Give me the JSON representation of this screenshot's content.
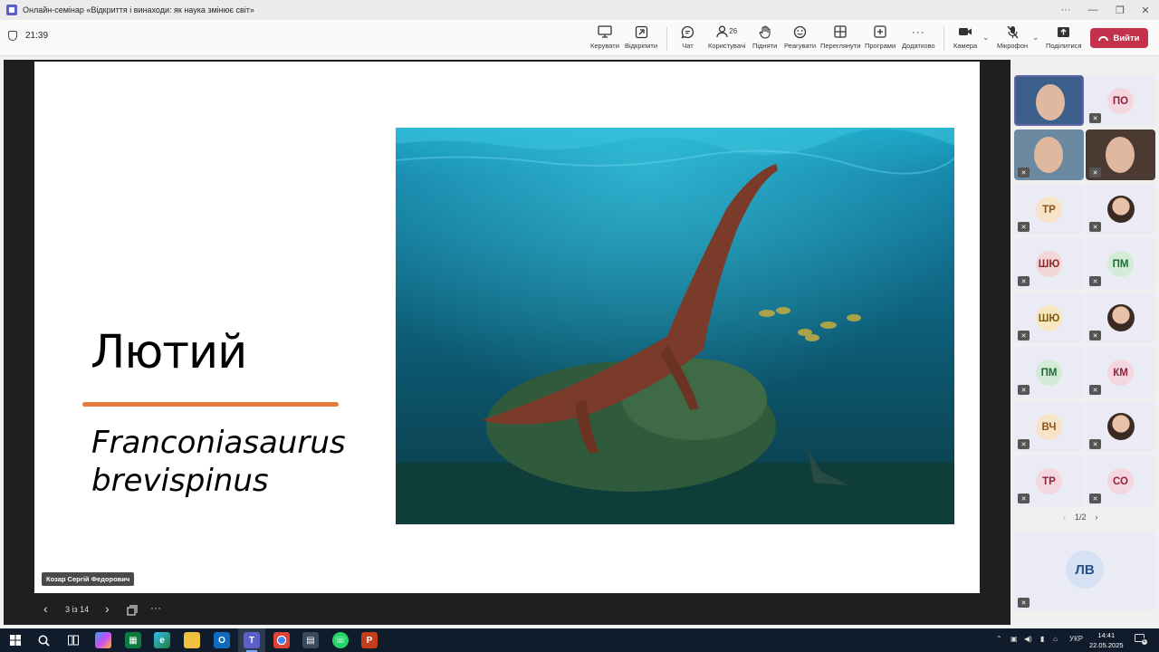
{
  "window": {
    "title": "Онлайн-семінар «Відкриття і винаходи: як наука змінює світ»",
    "controls": [
      "···",
      "—",
      "❐",
      "✕"
    ]
  },
  "meeting": {
    "timer": "21:39",
    "toolbar": {
      "manage": "Керувати",
      "unpin": "Відкріпити",
      "chat": "Чат",
      "people": "Користувачі",
      "people_count": "26",
      "raise": "Підняти",
      "react": "Реагувати",
      "view": "Переглянути",
      "apps": "Програми",
      "more": "Додатково",
      "camera": "Камера",
      "mic": "Мікрофон",
      "share": "Поділитися",
      "leave": "Вийти"
    }
  },
  "slide": {
    "title": "Лютий",
    "subtitle_line1": "Franconiasaurus",
    "subtitle_line2": "brevispinus",
    "presenter": "Козар Сергій Федорович",
    "counter": "3 із 14",
    "accent_line_color": "#e57b3a"
  },
  "participants": {
    "tiles": [
      {
        "initials": "",
        "type": "video"
      },
      {
        "initials": "ПО",
        "bg": "#f4d6de",
        "fg": "#8e2340"
      },
      {
        "initials": "",
        "type": "video"
      },
      {
        "initials": "",
        "type": "video"
      },
      {
        "initials": "ТР",
        "bg": "#f7e3c8",
        "fg": "#8a5318"
      },
      {
        "initials": "",
        "type": "photo"
      },
      {
        "initials": "ШЮ",
        "bg": "#f3d7d7",
        "fg": "#8a2a2a"
      },
      {
        "initials": "ПМ",
        "bg": "#d3ecd8",
        "fg": "#1f6b34"
      },
      {
        "initials": "ШЮ",
        "bg": "#f7e8c3",
        "fg": "#7d5a12"
      },
      {
        "initials": "",
        "type": "photo"
      },
      {
        "initials": "ПМ",
        "bg": "#d3ecd8",
        "fg": "#1f6b34"
      },
      {
        "initials": "КМ",
        "bg": "#f4d6de",
        "fg": "#8e2340"
      },
      {
        "initials": "ВЧ",
        "bg": "#f7e3c8",
        "fg": "#8a5318"
      },
      {
        "initials": "",
        "type": "photo"
      },
      {
        "initials": "ТР",
        "bg": "#f4d6de",
        "fg": "#8e2340"
      },
      {
        "initials": "СО",
        "bg": "#f4d6de",
        "fg": "#8e2340"
      }
    ],
    "pager": "1/2",
    "big_tile_initials": "ЛВ"
  },
  "taskbar": {
    "language": "УКР",
    "time": "14:41",
    "date": "22.05.2025",
    "notification_count": "1"
  }
}
